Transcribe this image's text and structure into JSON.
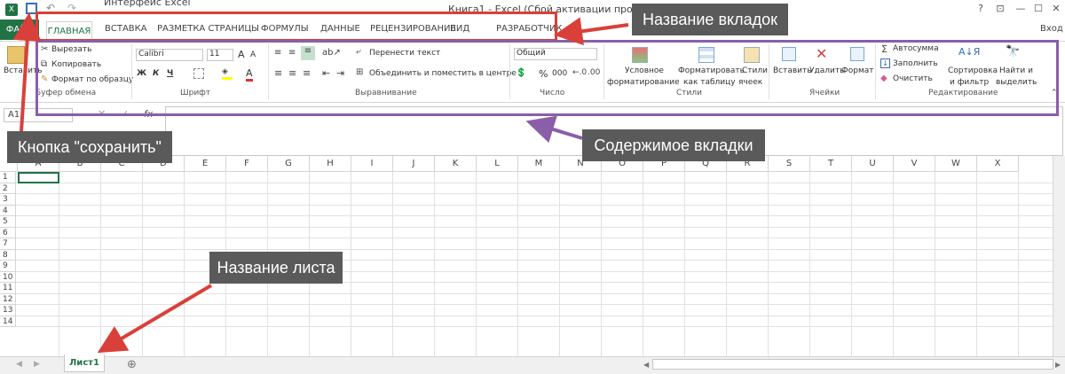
{
  "window": {
    "doc_title": "Интерфейс Excel",
    "title": "Книга1 - Excel (Сбой активации продукта)",
    "help": "?",
    "ribbon_opts": "⊡",
    "minimize": "—",
    "maximize": "☐",
    "close": "✕",
    "login": "Вход"
  },
  "tabs": {
    "file": "ФАЙЛ",
    "home": "ГЛАВНАЯ",
    "insert": "ВСТАВКА",
    "page_layout": "РАЗМЕТКА СТРАНИЦЫ",
    "formulas": "ФОРМУЛЫ",
    "data": "ДАННЫЕ",
    "review": "РЕЦЕНЗИРОВАНИЕ",
    "view": "ВИД",
    "developer": "РАЗРАБОТЧИК"
  },
  "ribbon": {
    "clipboard": {
      "paste": "Вставить",
      "cut": "Вырезать",
      "copy": "Копировать",
      "format_painter": "Формат по образцу",
      "label": "Буфер обмена"
    },
    "font": {
      "name": "Calibri",
      "size": "11",
      "bold": "Ж",
      "italic": "К",
      "underline": "Ч",
      "grow": "A",
      "shrink": "A",
      "color_a": "A",
      "label": "Шрифт"
    },
    "alignment": {
      "wrap": "Перенести текст",
      "merge": "Объединить и поместить в центре",
      "label": "Выравнивание"
    },
    "number": {
      "format": "Общий",
      "percent": "%",
      "thousands": "000",
      "label": "Число"
    },
    "styles": {
      "conditional1": "Условное",
      "conditional2": "форматирование",
      "table1": "Форматировать",
      "table2": "как таблицу",
      "cell1": "Стили",
      "cell2": "ячеек",
      "label": "Стили"
    },
    "cells": {
      "insert": "Вставить",
      "delete": "Удалить",
      "format": "Формат",
      "label": "Ячейки"
    },
    "editing": {
      "autosum": "Автосумма",
      "fill": "Заполнить",
      "clear": "Очистить",
      "sort1": "Сортировка",
      "sort2": "и фильтр",
      "find1": "Найти и",
      "find2": "выделить",
      "label": "Редактирование"
    }
  },
  "formula_bar": {
    "namebox": "A1",
    "fx": "fx"
  },
  "grid": {
    "columns": [
      "A",
      "B",
      "C",
      "D",
      "E",
      "F",
      "G",
      "H",
      "I",
      "J",
      "K",
      "L",
      "M",
      "N",
      "O",
      "P",
      "Q",
      "R",
      "S",
      "T",
      "U",
      "V",
      "W",
      "X"
    ],
    "rows": [
      "1",
      "2",
      "3",
      "4",
      "5",
      "6",
      "7",
      "8",
      "9",
      "10",
      "11",
      "12",
      "13",
      "14"
    ]
  },
  "sheet": {
    "name": "Лист1",
    "add": "⊕"
  },
  "annotations": {
    "tabs_name": "Название вкладок",
    "tab_content": "Содержимое вкладки",
    "save_button": "Кнопка \"сохранить\"",
    "sheet_name": "Название листа"
  },
  "colors": {
    "excel_green": "#217346",
    "red": "#d9403a",
    "purple": "#8a5ea8",
    "callout_bg": "#5a5a5a"
  }
}
